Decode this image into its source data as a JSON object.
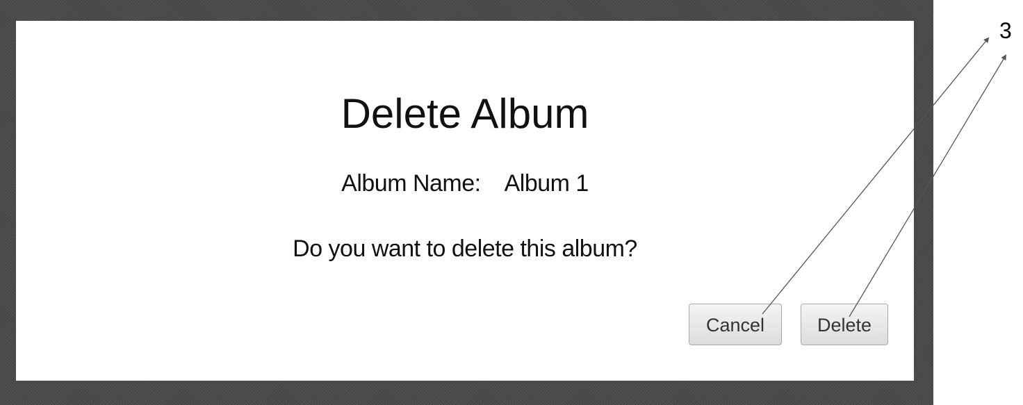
{
  "dialog": {
    "title": "Delete Album",
    "album_name_label": "Album Name:",
    "album_name_value": "Album 1",
    "question": "Do you want to delete this album?",
    "cancel_label": "Cancel",
    "delete_label": "Delete"
  },
  "annotation": {
    "number": "3"
  }
}
